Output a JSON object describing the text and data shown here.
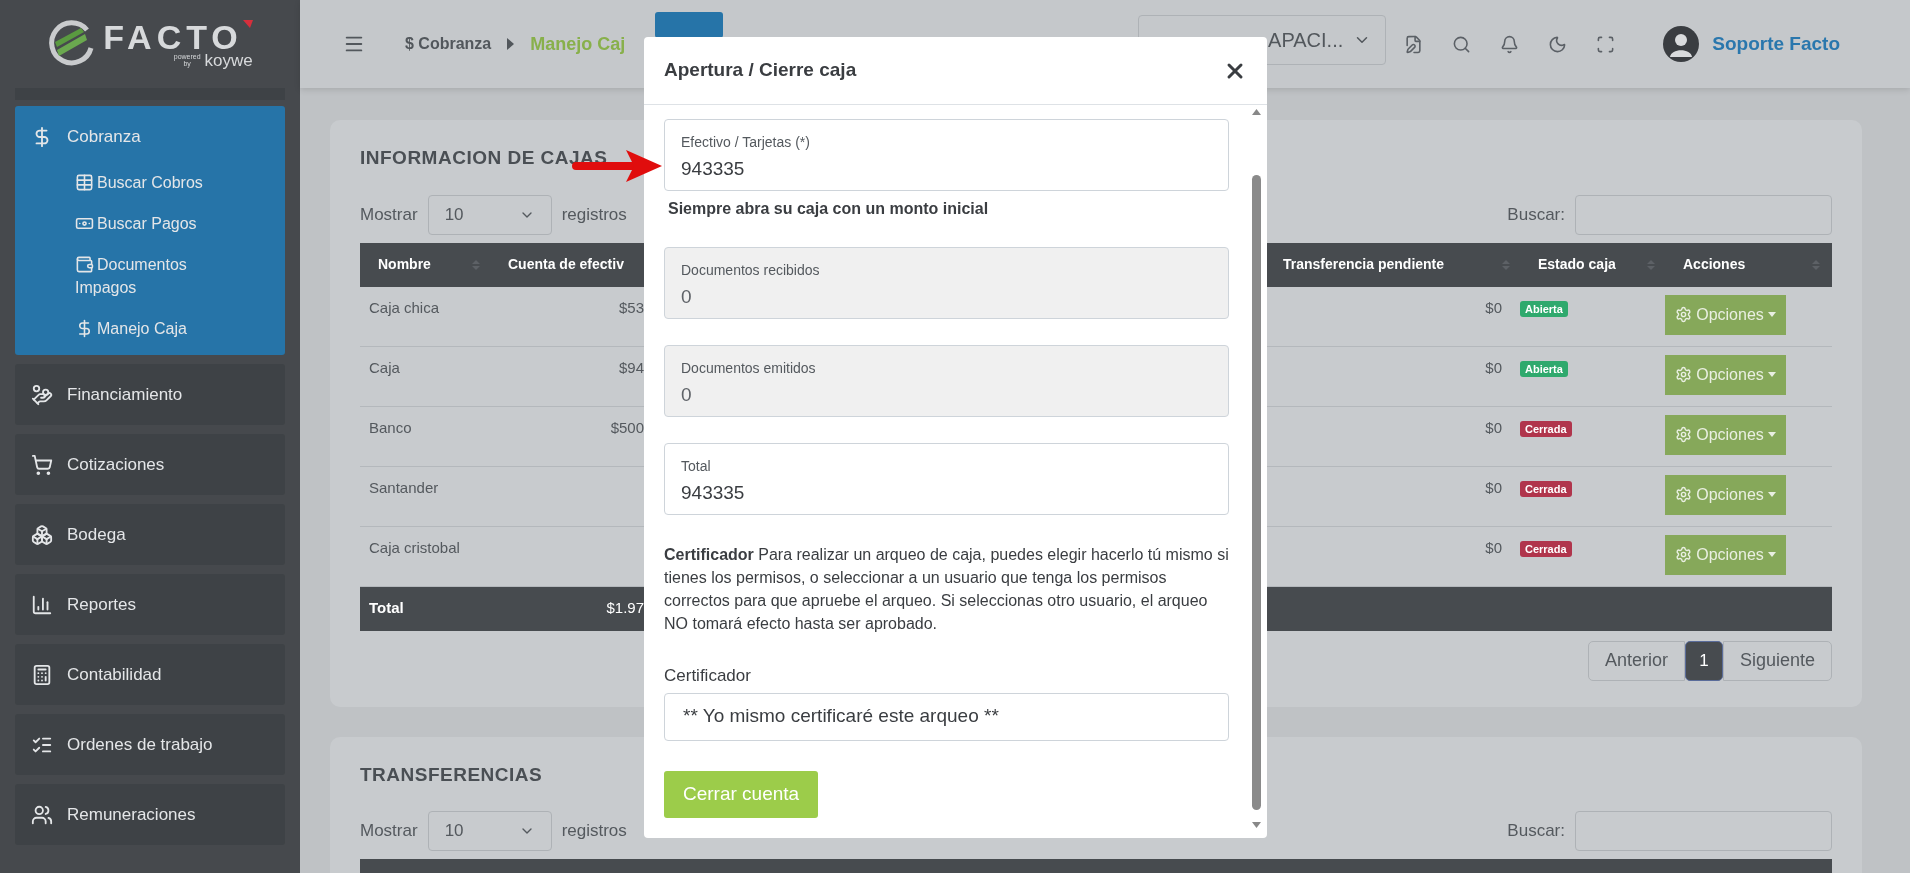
{
  "sidebar": {
    "logo": {
      "name": "FACTO",
      "powered": "powered",
      "by": "by",
      "brand": "koywe"
    },
    "items": [
      {
        "label": "Cobranza",
        "selected": true,
        "children": [
          {
            "label": "Buscar Cobros"
          },
          {
            "label": "Buscar Pagos"
          },
          {
            "label": "Documentos Impagos"
          },
          {
            "label": "Manejo Caja"
          }
        ]
      },
      {
        "label": "Financiamiento",
        "selected": false
      },
      {
        "label": "Cotizaciones",
        "selected": false
      },
      {
        "label": "Bodega",
        "selected": false
      },
      {
        "label": "Reportes",
        "selected": false
      },
      {
        "label": "Contabilidad",
        "selected": false
      },
      {
        "label": "Ordenes de trabajo",
        "selected": false
      },
      {
        "label": "Remuneraciones",
        "selected": false
      }
    ]
  },
  "topbar": {
    "breadcrumb": [
      {
        "label": "$ Cobranza"
      },
      {
        "label": "Manejo Caj"
      }
    ],
    "company_select": "APACI...",
    "user": "Soporte Facto"
  },
  "cajas": {
    "title": "INFORMACION DE CAJAS",
    "show_label": "Mostrar",
    "show_value": "10",
    "show_suffix": "registros",
    "search_label": "Buscar:",
    "columns": [
      "Nombre",
      "Cuenta de efectiv",
      "Transferencia pendiente",
      "Estado caja",
      "Acciones"
    ],
    "rows": [
      {
        "name": "Caja chica",
        "cuenta": "$53",
        "transferencia": "$0",
        "estado": "Abierta",
        "color": "#2fa96d",
        "action": "Opciones"
      },
      {
        "name": "Caja",
        "cuenta": "$94",
        "transferencia": "$0",
        "estado": "Abierta",
        "color": "#2fa96d",
        "action": "Opciones"
      },
      {
        "name": "Banco",
        "cuenta": "$500",
        "transferencia": "$0",
        "estado": "Cerrada",
        "color": "#b0354c",
        "action": "Opciones"
      },
      {
        "name": "Santander",
        "transferencia": "$0",
        "estado": "Cerrada",
        "color": "#b0354c",
        "action": "Opciones"
      },
      {
        "name": "Caja cristobal",
        "transferencia": "$0",
        "estado": "Cerrada",
        "color": "#b0354c",
        "action": "Opciones"
      }
    ],
    "total": {
      "label": "Total",
      "cuenta": "$1.97"
    },
    "pagination": {
      "prev": "Anterior",
      "pages": [
        {
          "label": "1",
          "selected": true
        }
      ],
      "next": "Siguiente"
    }
  },
  "transferencias": {
    "title": "TRANSFERENCIAS",
    "show_label": "Mostrar",
    "show_value": "10",
    "show_suffix": "registros",
    "search_label": "Buscar:"
  },
  "modal": {
    "title": "Apertura / Cierre caja",
    "fields": [
      {
        "label": "Efectivo / Tarjetas (*)",
        "value": "943335",
        "disabled": false,
        "hint": "Siempre abra su caja con un monto inicial"
      },
      {
        "label": "Documentos recibidos",
        "value": "0",
        "disabled": true
      },
      {
        "label": "Documentos emitidos",
        "value": "0",
        "disabled": true
      },
      {
        "label": "Total",
        "value": "943335",
        "disabled": false
      }
    ],
    "note": "**Certificador** Para realizar un arqueo de caja, puedes elegir hacerlo tú mismo si tienes los permisos, o seleccionar a un usuario que tenga los permisos correctos para que apruebe el arqueo. Si seleccionas otro usuario, el arqueo NO tomará efecto hasta ser aprobado.",
    "certifier_label": "Certificador",
    "certifier_value": "** Yo mismo certificaré este arqueo **",
    "submit": "Cerrar cuenta"
  }
}
